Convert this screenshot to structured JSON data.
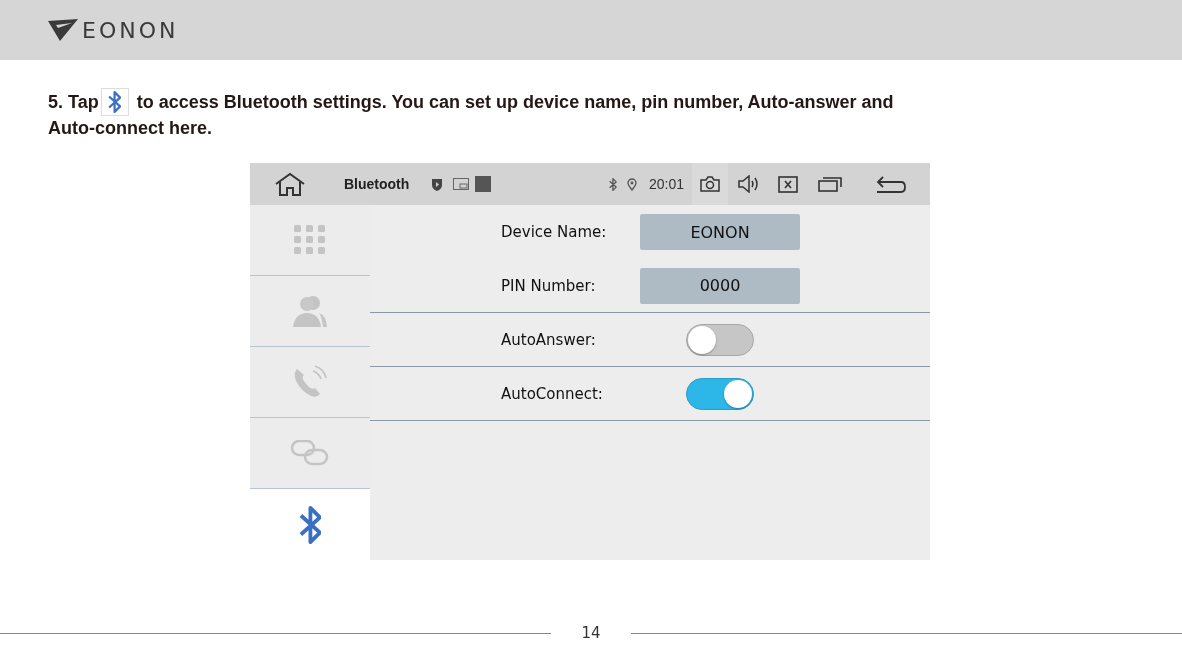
{
  "header": {
    "logo": "EONON"
  },
  "instruction": {
    "before": "5. Tap",
    "after": "to access Bluetooth settings. You can set up device name, pin number, Auto-answer and",
    "continued": "Auto-connect here."
  },
  "screen": {
    "topbar": {
      "title": "Bluetooth",
      "time": "20:01"
    },
    "sidebar": [
      {
        "selected": false
      },
      {
        "selected": false
      },
      {
        "selected": false
      },
      {
        "selected": false
      },
      {
        "selected": true
      }
    ],
    "settings": [
      {
        "kind": "field",
        "label": "Device Name:",
        "value": "EONON"
      },
      {
        "kind": "field",
        "label": "PIN Number:",
        "value": "0000"
      },
      {
        "kind": "toggle",
        "label": "AutoAnswer:",
        "on": false
      },
      {
        "kind": "toggle",
        "label": "AutoConnect:",
        "on": true
      }
    ]
  },
  "footer": {
    "page": "14"
  }
}
